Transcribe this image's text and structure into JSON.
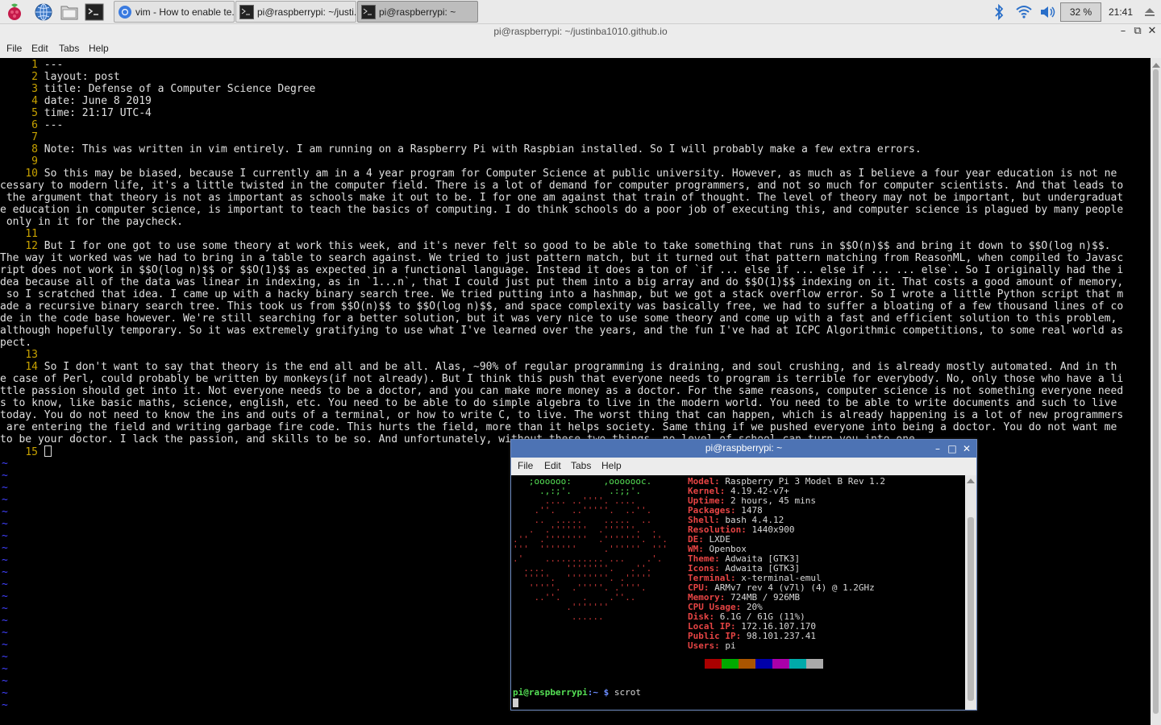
{
  "taskbar": {
    "launchers": [
      {
        "icon": "raspberry-menu-icon"
      },
      {
        "icon": "web-browser-icon"
      },
      {
        "icon": "file-manager-icon"
      },
      {
        "icon": "terminal-icon"
      }
    ],
    "tasks": [
      {
        "label": "vim - How to enable te...",
        "icon": "chromium-icon",
        "active": false
      },
      {
        "label": "pi@raspberrypi: ~/justi...",
        "icon": "terminal-icon",
        "active": false
      },
      {
        "label": "pi@raspberrypi: ~",
        "icon": "terminal-icon",
        "active": true
      }
    ],
    "cpu_percent": "32 %",
    "clock": "21:41"
  },
  "main_window": {
    "title": "pi@raspberrypi: ~/justinba1010.github.io",
    "menu": [
      "File",
      "Edit",
      "Tabs",
      "Help"
    ]
  },
  "editor": {
    "lines": [
      {
        "n": "1",
        "text": "---"
      },
      {
        "n": "2",
        "text": "layout: post"
      },
      {
        "n": "3",
        "text": "title: Defense of a Computer Science Degree"
      },
      {
        "n": "4",
        "text": "date: June 8 2019"
      },
      {
        "n": "5",
        "text": "time: 21:17 UTC-4"
      },
      {
        "n": "6",
        "text": "---"
      },
      {
        "n": "7",
        "text": ""
      },
      {
        "n": "8",
        "text": "Note: This was written in vim entirely. I am running on a Raspberry Pi with Raspbian installed. So I will probably make a few extra errors."
      },
      {
        "n": "9",
        "text": ""
      },
      {
        "n": "10",
        "text": "So this may be biased, because I currently am in a 4 year program for Computer Science at public university. However, as much as I believe a four year education is not ne"
      },
      {
        "n": "",
        "text": "cessary to modern life, it's a little twisted in the computer field. There is a lot of demand for computer programmers, and not so much for computer scientists. And that leads to"
      },
      {
        "n": "",
        "text": " the argument that theory is not as important as schools make it out to be. I for one am against that train of thought. The level of theory may not be important, but undergraduat"
      },
      {
        "n": "",
        "text": "e education in computer science, is important to teach the basics of computing. I do think schools do a poor job of executing this, and computer science is plagued by many people"
      },
      {
        "n": "",
        "text": " only in it for the paycheck."
      },
      {
        "n": "11",
        "text": ""
      },
      {
        "n": "12",
        "text": "But I for one got to use some theory at work this week, and it's never felt so good to be able to take something that runs in $$O(n)$$ and bring it down to $$O(log n)$$."
      },
      {
        "n": "",
        "text": "The way it worked was we had to bring in a table to search against. We tried to just pattern match, but it turned out that pattern matching from ReasonML, when compiled to Javasc"
      },
      {
        "n": "",
        "text": "ript does not work in $$O(log n)$$ or $$O(1)$$ as expected in a functional language. Instead it does a ton of `if ... else if ... else if ... ... else`. So I originally had the i"
      },
      {
        "n": "",
        "text": "dea because all of the data was linear in indexing, as in `1...n`, that I could just put them into a big array and do $$O(1)$$ indexing on it. That costs a good amount of memory,"
      },
      {
        "n": "",
        "text": " so I scratched that idea. I came up with a hacky binary search tree. We tried putting into a hashmap, but we got a stack overflow error. So I wrote a little Python script that m"
      },
      {
        "n": "",
        "text": "ade a recursive binary search tree. This took us from $$O(n)$$ to $$O(log n)$$, and space complexity was basically free, we had to suffer a bloating of a few thousand lines of co"
      },
      {
        "n": "",
        "text": "de in the code base however. We're still searching for a better solution, but it was very nice to use some theory and come up with a fast and efficient solution to this problem,"
      },
      {
        "n": "",
        "text": "although hopefully temporary. So it was extremely gratifying to use what I've learned over the years, and the fun I've had at ICPC Algorithmic competitions, to some real world as"
      },
      {
        "n": "",
        "text": "pect."
      },
      {
        "n": "13",
        "text": ""
      },
      {
        "n": "14",
        "text": "So I don't want to say that theory is the end all and be all. Alas, ~90% of regular programming is draining, and soul crushing, and is already mostly automated. And in th"
      },
      {
        "n": "",
        "text": "e case of Perl, could probably be written by monkeys(if not already). But I think this push that everyone needs to program is terrible for everybody. No, only those who have a li"
      },
      {
        "n": "",
        "text": "ttle passion should get into it. Not everyone needs to be a doctor, and you can make more money as a doctor. For the same reasons, computer science is not something everyone need"
      },
      {
        "n": "",
        "text": "s to know, like basic maths, science, english, etc. You need to be able to do simple algebra to live in the modern world. You need to be able to write documents and such to live"
      },
      {
        "n": "",
        "text": "today. You do not need to know the ins and outs of a terminal, or how to write C, to live. The worst thing that can happen, which is already happening is a lot of new programmers"
      },
      {
        "n": "",
        "text": " are entering the field and writing garbage fire code. This hurts the field, more than it helps society. Same thing if we pushed everyone into being a doctor. You do not want me"
      },
      {
        "n": "",
        "text": "to be your doctor. I lack the passion, and skills to be so. And unfortunately, without these two things, no level of school can turn you into one."
      },
      {
        "n": "15",
        "text": ""
      }
    ],
    "tilde": "~"
  },
  "terminal": {
    "title": "pi@raspberrypi: ~",
    "menu": [
      "File",
      "Edit",
      "Tabs",
      "Help"
    ],
    "art_green": [
      "   ;oooooo:      ,ooooooc.",
      "     .,:;'.       .:;;'."
    ],
    "art_red": [
      "      .... ..''''. ....",
      "    .''.   ..'''''.  ..''.",
      "    ..  .....    .....  ..",
      "   .  .'''''''  .''''''.  .",
      ".''  .''''''''  .'''''''. ''.",
      "'''  '''''''     .''''''  '''",
      ".'    ........... ...    .'.",
      "  ....    ''''''''.   .''.",
      "  '''''.  ''''''''. .'''''",
      "   '''''.  .'''''. .''''.",
      "    ..''.    .    .''..",
      "          .'''''''",
      "           ......"
    ],
    "info": [
      {
        "k": "Model:",
        "v": "Raspberry Pi 3 Model B Rev 1.2"
      },
      {
        "k": "Kernel:",
        "v": "4.19.42-v7+"
      },
      {
        "k": "Uptime:",
        "v": "2 hours, 45 mins"
      },
      {
        "k": "Packages:",
        "v": "1478"
      },
      {
        "k": "Shell:",
        "v": "bash 4.4.12"
      },
      {
        "k": "Resolution:",
        "v": "1440x900"
      },
      {
        "k": "DE:",
        "v": "LXDE"
      },
      {
        "k": "WM:",
        "v": "Openbox"
      },
      {
        "k": "Theme:",
        "v": "Adwaita [GTK3]"
      },
      {
        "k": "Icons:",
        "v": "Adwaita [GTK3]"
      },
      {
        "k": "Terminal:",
        "v": "x-terminal-emul"
      },
      {
        "k": "CPU:",
        "v": "ARMv7 rev 4 (v7l) (4) @ 1.2GHz"
      },
      {
        "k": "Memory:",
        "v": "724MB / 926MB"
      },
      {
        "k": "CPU Usage:",
        "v": "20%"
      },
      {
        "k": "Disk:",
        "v": "6.1G / 61G (11%)"
      },
      {
        "k": "Local IP:",
        "v": "172.16.107.170"
      },
      {
        "k": "Public IP:",
        "v": "98.101.237.41"
      },
      {
        "k": "Users:",
        "v": "pi"
      }
    ],
    "palette": [
      "#000000",
      "#aa0000",
      "#00aa00",
      "#aa5500",
      "#0000aa",
      "#aa00aa",
      "#00aaaa",
      "#aaaaaa"
    ],
    "prompt_user": "pi@raspberrypi",
    "prompt_path": ":~ $",
    "command": " scrot"
  },
  "colors": {
    "line_number": "#c8a200",
    "tilde": "#4040ff",
    "terminal_title": "#4d73b4",
    "art_red": "#d23a3a",
    "art_green": "#55e055"
  }
}
